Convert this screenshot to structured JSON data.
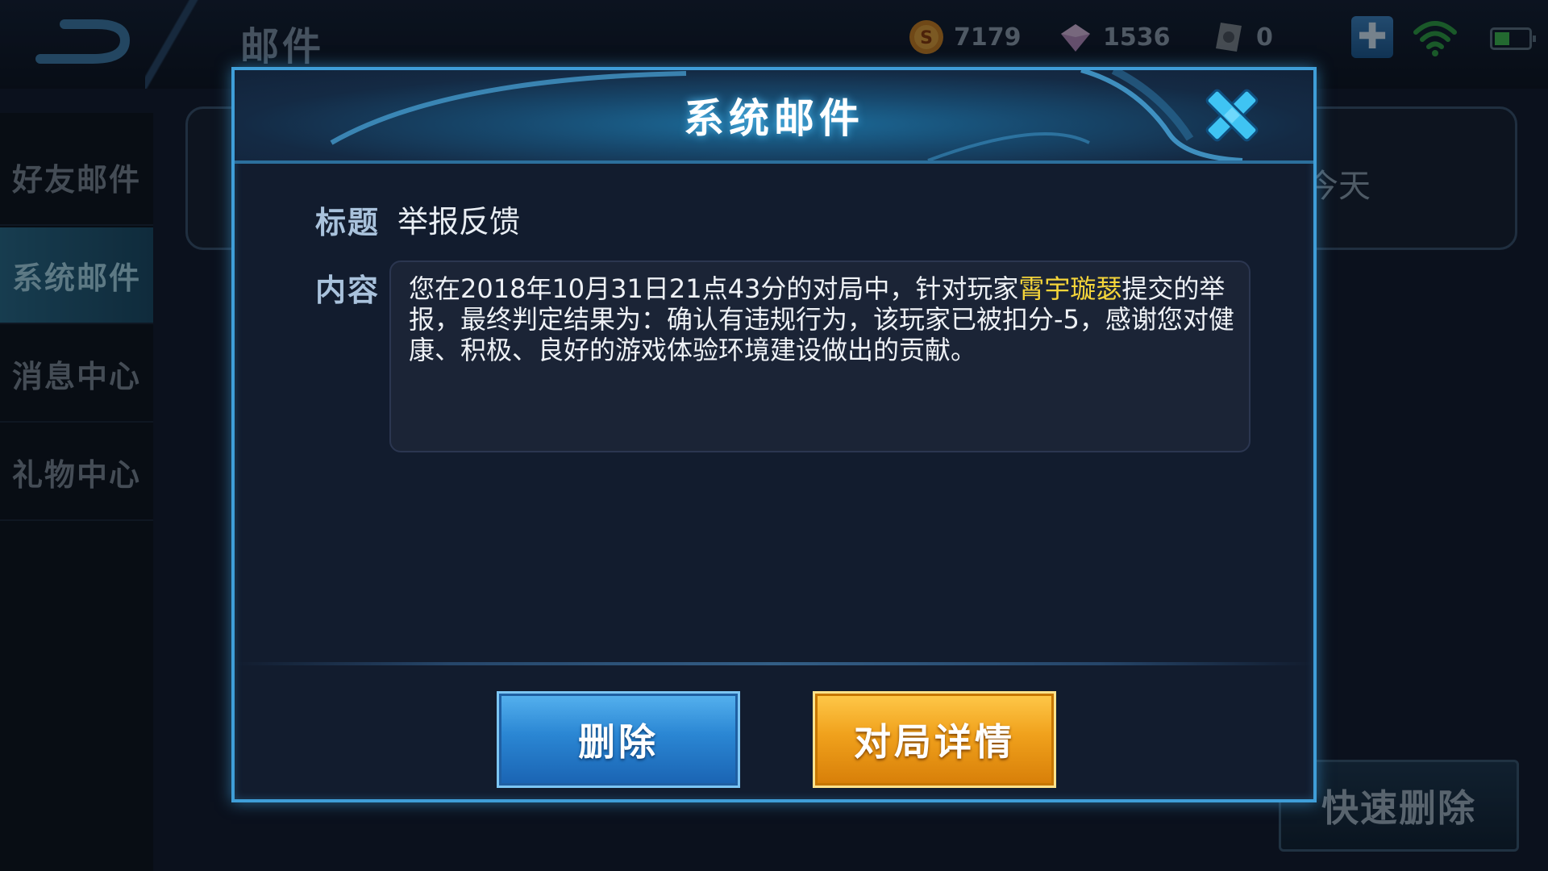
{
  "header": {
    "page_title": "邮件",
    "gold": "7179",
    "diamond": "1536",
    "voucher": "0",
    "plus": "✚"
  },
  "sidebar": {
    "items": [
      {
        "label": "好友邮件",
        "active": false
      },
      {
        "label": "系统邮件",
        "active": true
      },
      {
        "label": "消息中心",
        "active": false
      },
      {
        "label": "礼物中心",
        "active": false
      }
    ]
  },
  "list": {
    "date_label": "今天"
  },
  "quick_delete_label": "快速删除",
  "dialog": {
    "title": "系统邮件",
    "subject_label": "标题",
    "subject_value": "举报反馈",
    "content_label": "内容",
    "content_before": "您在2018年10月31日21点43分的对局中，针对玩家",
    "content_highlight": "霄宇璇瑟",
    "content_after": "提交的举报，最终判定结果为：确认有违规行为，该玩家已被扣分-5，感谢您对健康、积极、良好的游戏体验环境建设做出的贡献。",
    "delete_label": "删除",
    "detail_label": "对局详情"
  },
  "colors": {
    "highlight": "#f5d53a",
    "dialog_border": "#3f9ed8",
    "delete_button": "#2a86d3",
    "detail_button": "#f0a11c"
  }
}
